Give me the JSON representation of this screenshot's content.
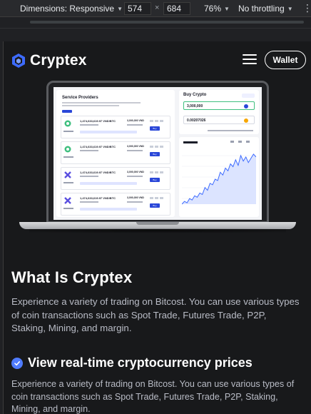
{
  "devtools": {
    "dimensions_label": "Dimensions: Responsive",
    "width_value": "574",
    "times": "×",
    "height_value": "684",
    "zoom": "76%",
    "throttling": "No throttling",
    "more": "⋮",
    "dropdown_glyph": "▼"
  },
  "nav": {
    "brand": "Cryptex",
    "wallet_button": "Wallet"
  },
  "screen": {
    "service_title": "Service Providers",
    "buy_title": "Buy Crypto",
    "buy_amount": "3,000,000",
    "buy_receive": "0.00207026",
    "providers": [
      {
        "amount": "1,474,633,619.97 VND/BTC",
        "limit": "3,000,000 VND"
      },
      {
        "amount": "1,474,633,619.97 VND/BTC",
        "limit": "3,000,000 VND"
      },
      {
        "amount": "1,474,633,619.97 VND/BTC",
        "limit": "3,000,000 VND"
      },
      {
        "amount": "1,474,633,619.97 VND/BTC",
        "limit": "3,000,000 VND"
      }
    ],
    "buy_button": "Buy",
    "chart_series": [
      12,
      14,
      13,
      16,
      15,
      18,
      17,
      20,
      19,
      24,
      22,
      27,
      26,
      30,
      29,
      35,
      33,
      38,
      36,
      41,
      39,
      44,
      40,
      47,
      43,
      46,
      42,
      45,
      48,
      46
    ]
  },
  "content": {
    "heading": "What Is Cryptex",
    "paragraph": "Experience a variety of trading on Bitcost. You can use various types of coin transactions such as Spot Trade, Futures Trade, P2P, Staking, Mining, and margin.",
    "feature_title": "View real-time cryptocurrency prices",
    "feature_paragraph": "Experience a variety of trading on Bitcost. You can use various types of coin transactions such as Spot Trade, Futures Trade, P2P, Staking, Mining, and margin."
  },
  "colors": {
    "accent": "#4f7bff",
    "brand_blue": "#2a47d8",
    "background": "#18191b"
  }
}
